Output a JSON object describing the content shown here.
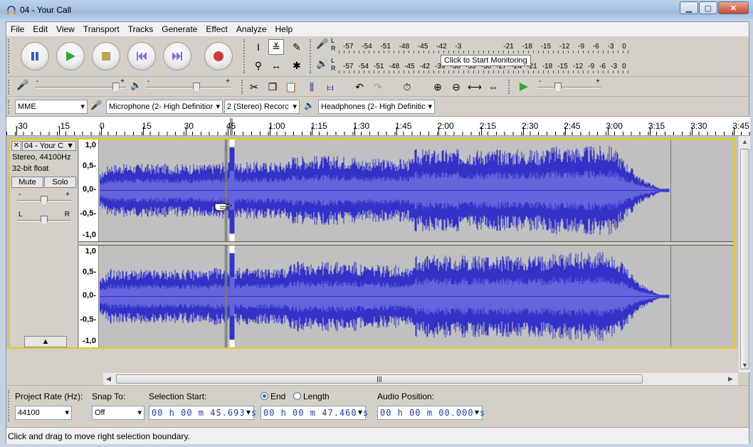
{
  "window": {
    "title": "04 - Your Call"
  },
  "menu": [
    "File",
    "Edit",
    "View",
    "Transport",
    "Tracks",
    "Generate",
    "Effect",
    "Analyze",
    "Help"
  ],
  "meters": {
    "record_scale": [
      "-57",
      "-54",
      "-51",
      "-48",
      "-45",
      "-42",
      "-3",
      "",
      "",
      "",
      "",
      "-21",
      "-18",
      "-15",
      "-12",
      "-9",
      "-6",
      "-3",
      "0"
    ],
    "playback_scale": [
      "-57",
      "-54",
      "-51",
      "-48",
      "-45",
      "-42",
      "-39",
      "-36",
      "-33",
      "-30",
      "-27",
      "-24",
      "-21",
      "-18",
      "-15",
      "-12",
      "-9",
      "-6",
      "-3",
      "0"
    ],
    "tooltip": "Click to Start Monitoring",
    "channel_l": "L",
    "channel_r": "R"
  },
  "sliders": {
    "minus": "-",
    "plus": "+",
    "input_volume_level": 0.92,
    "output_volume_level": 0.6,
    "play_speed_level": 0.3
  },
  "devices": {
    "host": "MME",
    "input": "Microphone (2- High Definitior",
    "channels": "2 (Stereo) Recorc",
    "output": "Headphones (2- High Definitic"
  },
  "ruler": {
    "labels": [
      "-30",
      "-15",
      "0",
      "15",
      "30",
      "45",
      "1:00",
      "1:15",
      "1:30",
      "1:45",
      "2:00",
      "2:15",
      "2:30",
      "2:45",
      "3:00",
      "3:15",
      "3:30",
      "3:45"
    ]
  },
  "track": {
    "name": "04 - Your C",
    "format": "Stereo, 44100Hz",
    "bit_depth": "32-bit float",
    "mute": "Mute",
    "solo": "Solo",
    "pan_l": "L",
    "pan_r": "R",
    "gain_minus": "-",
    "gain_plus": "+",
    "gain_level": 0.5,
    "pan_level": 0.5,
    "scale": [
      "1,0",
      "0,5-",
      "0,0-",
      "-0,5-",
      "-1,0"
    ],
    "selection_start_s": 45.693,
    "selection_end_s": 47.46,
    "audio_end_s": 202
  },
  "colors": {
    "waveform": "#3232c8",
    "waveform_rms": "#6464dc",
    "selection_bg": "#ffffff",
    "track_border": "#e6c916"
  },
  "selection_bar": {
    "project_rate_label": "Project Rate (Hz):",
    "project_rate": "44100",
    "snap_label": "Snap To:",
    "snap_value": "Off",
    "sel_start_label": "Selection Start:",
    "end_label": "End",
    "length_label": "Length",
    "audio_pos_label": "Audio Position:",
    "sel_start": "00 h 00 m 45.693 s",
    "sel_end": "00 h 00 m 47.460 s",
    "audio_pos": "00 h 00 m 00.000 s"
  },
  "status": "Click and drag to move right selection boundary."
}
